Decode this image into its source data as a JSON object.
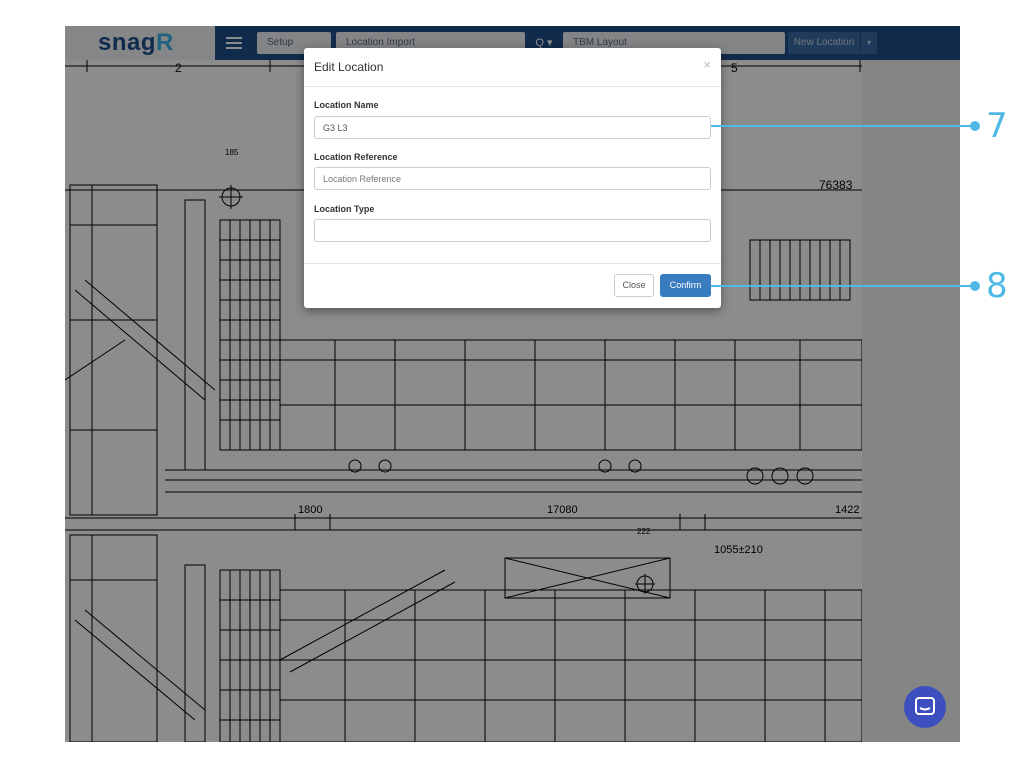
{
  "app": {
    "logo_text": "snag",
    "logo_accent": "R"
  },
  "navbar": {
    "setup": "Setup",
    "location_import": "Location Import",
    "search_label": "Q ▾",
    "layout_select": "TBM Layout",
    "new_location": "New Location",
    "new_location_caret": "▾"
  },
  "drawing": {
    "grid_numbers": [
      "2",
      "5"
    ],
    "dimensions": [
      "76383",
      "1800",
      "17080",
      "1422",
      "1055±210"
    ],
    "markers": [
      "185",
      "222"
    ]
  },
  "modal": {
    "title": "Edit Location",
    "close_glyph": "×",
    "fields": {
      "location_name": {
        "label": "Location Name",
        "value": "G3 L3",
        "placeholder": ""
      },
      "location_reference": {
        "label": "Location Reference",
        "value": "",
        "placeholder": "Location Reference"
      },
      "location_type": {
        "label": "Location Type",
        "value": "",
        "placeholder": ""
      }
    },
    "buttons": {
      "close": "Close",
      "confirm": "Confirm"
    }
  },
  "callouts": [
    "7",
    "8"
  ],
  "colors": {
    "nav_bg": "#1f4f8c",
    "accent": "#3cb4e7",
    "confirm_bg": "#3a7cc0",
    "chat_bg": "#3d4fbf"
  }
}
